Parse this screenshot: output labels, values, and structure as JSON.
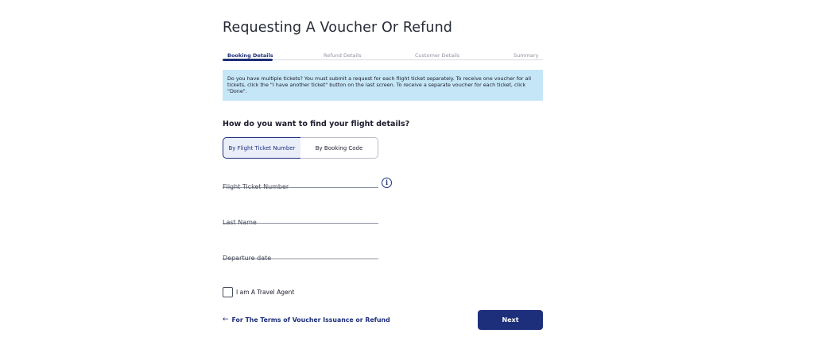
{
  "page": {
    "title": "Requesting A Voucher Or Refund"
  },
  "steps": [
    {
      "label": "Booking Details",
      "active": true
    },
    {
      "label": "Refund Details",
      "active": false
    },
    {
      "label": "Customer Details",
      "active": false
    },
    {
      "label": "Summary",
      "active": false
    }
  ],
  "notice": {
    "text": "Do you have multiple tickets? You must submit a request for each flight ticket separately. To receive one voucher for all tickets, click the \"I have another ticket\" button on the last screen. To receive a separate voucher for each ticket, click \"Done\"."
  },
  "search": {
    "question": "How do you want to find your flight details?",
    "options": [
      {
        "label": "By Flight Ticket Number",
        "selected": true
      },
      {
        "label": "By Booking Code",
        "selected": false
      }
    ]
  },
  "form": {
    "ticket_number": {
      "placeholder": "Flight Ticket Number",
      "value": ""
    },
    "last_name": {
      "placeholder": "Last Name",
      "value": ""
    },
    "departure_date": {
      "placeholder": "Departure date",
      "value": ""
    }
  },
  "travel_agent": {
    "label": "I am A Travel Agent",
    "checked": false
  },
  "footer": {
    "arrow": "←",
    "terms_label": "For The Terms of Voucher Issuance or Refund",
    "next_label": "Next"
  },
  "icons": {
    "info": "i"
  },
  "colors": {
    "primary": "#1d2f7a",
    "notice_bg": "#c5e6f6",
    "selected_bg": "#e9eef9"
  }
}
